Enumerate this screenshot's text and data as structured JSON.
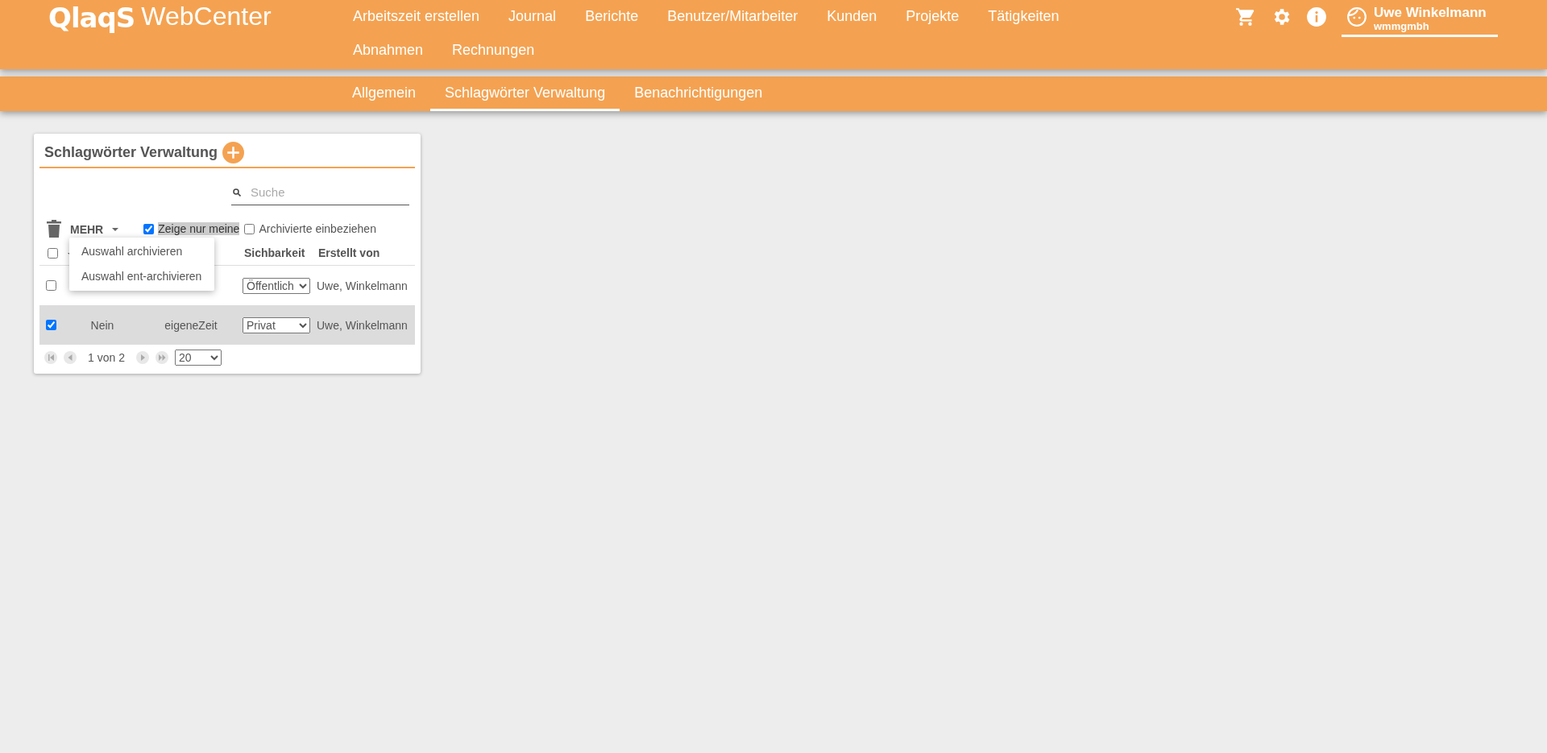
{
  "header": {
    "logo": "QlaqS",
    "product": "WebCenter",
    "nav": [
      {
        "label": "Arbeitszeit erstellen"
      },
      {
        "label": "Journal"
      },
      {
        "label": "Berichte"
      },
      {
        "label": "Benutzer/Mitarbeiter"
      },
      {
        "label": "Kunden"
      },
      {
        "label": "Projekte"
      },
      {
        "label": "Tätigkeiten"
      },
      {
        "label": "Abnahmen"
      },
      {
        "label": "Rechnungen"
      }
    ],
    "user": {
      "name": "Uwe Winkelmann",
      "company": "wmmgmbh"
    }
  },
  "subnav": [
    {
      "label": "Allgemein",
      "selected": false
    },
    {
      "label": "Schlagwörter Verwaltung",
      "selected": true
    },
    {
      "label": "Benachrichtigungen",
      "selected": false
    }
  ],
  "card": {
    "title": "Schlagwörter Verwaltung",
    "search": {
      "placeholder": "Suche"
    },
    "more": "MEHR",
    "filters": [
      {
        "label": "Zeige nur meine",
        "checked": true,
        "highlighted": true
      },
      {
        "label": "Archivierte einbeziehen",
        "checked": false,
        "highlighted": false
      }
    ],
    "menu": [
      "Auswahl archivieren",
      "Auswahl ent-archivieren"
    ],
    "table": {
      "select_all": false,
      "columns": [
        "Sichbarkeit",
        "Erstellt von"
      ],
      "rows": [
        {
          "selected": false,
          "visibility": "Öffentlich",
          "created_by": "Uwe, Winkelmann"
        },
        {
          "selected": true,
          "column_1": "Nein",
          "column_2": "eigeneZeit",
          "visibility": "Privat",
          "created_by": "Uwe, Winkelmann"
        }
      ]
    },
    "pagination": {
      "page": "1 von 2",
      "page_size": "20"
    }
  }
}
